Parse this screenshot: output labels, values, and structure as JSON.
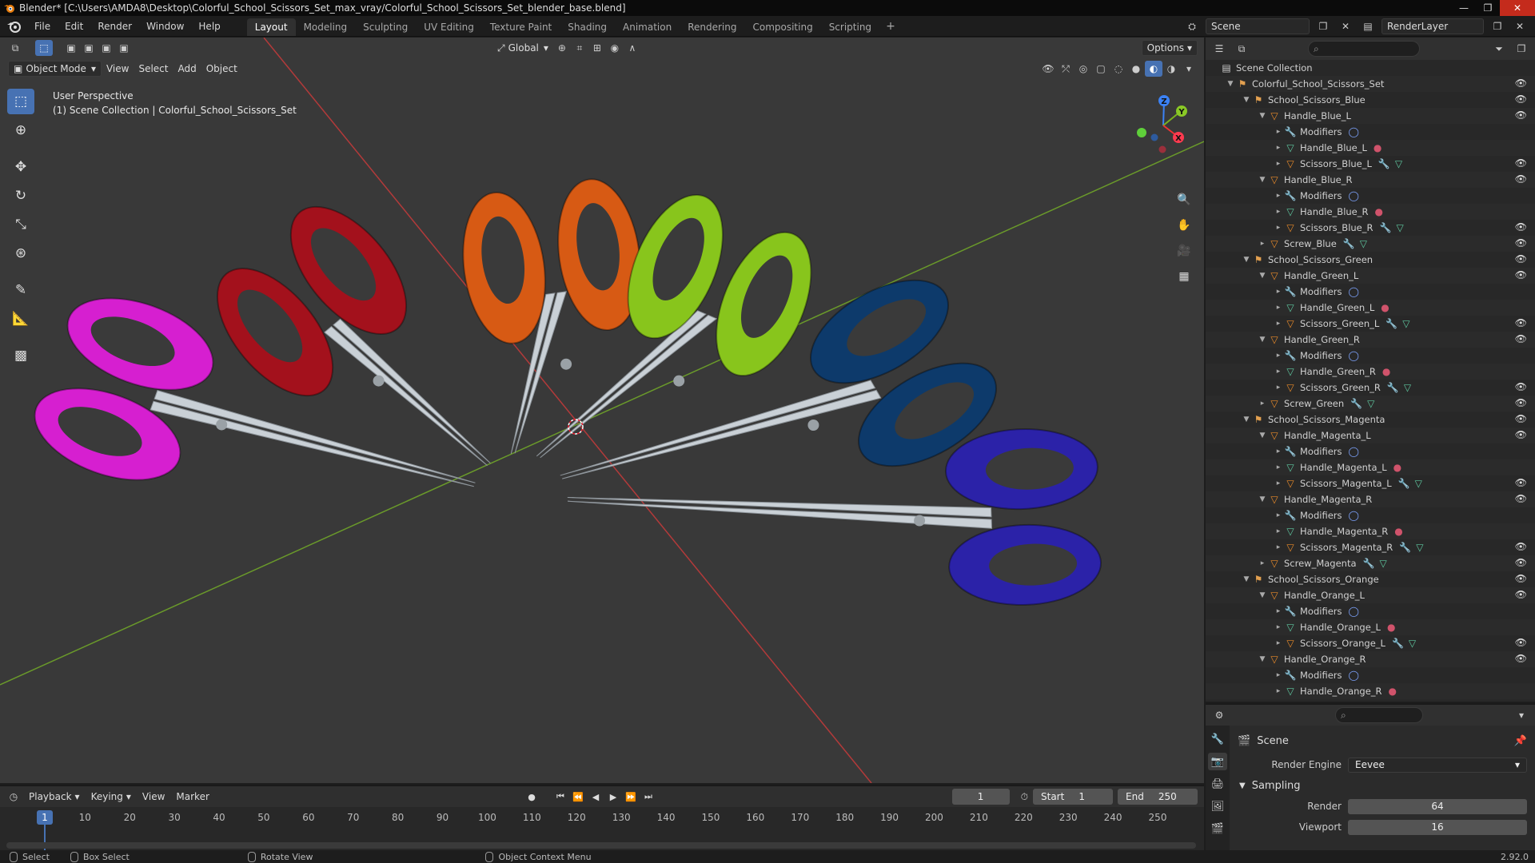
{
  "window": {
    "title": "Blender* [C:\\Users\\AMDA8\\Desktop\\Colorful_School_Scissors_Set_max_vray/Colorful_School_Scissors_Set_blender_base.blend]"
  },
  "menu": [
    "File",
    "Edit",
    "Render",
    "Window",
    "Help"
  ],
  "workspaces": [
    {
      "label": "Layout",
      "active": true
    },
    {
      "label": "Modeling"
    },
    {
      "label": "Sculpting"
    },
    {
      "label": "UV Editing"
    },
    {
      "label": "Texture Paint"
    },
    {
      "label": "Shading"
    },
    {
      "label": "Animation"
    },
    {
      "label": "Rendering"
    },
    {
      "label": "Compositing"
    },
    {
      "label": "Scripting"
    }
  ],
  "topright": {
    "scene": "Scene",
    "renderlayer": "RenderLayer"
  },
  "viewport": {
    "transform_orientation": "Global",
    "options_label": "Options",
    "mode": "Object Mode",
    "menus": [
      "View",
      "Select",
      "Add",
      "Object"
    ],
    "perspective_text": "User Perspective",
    "collection_text": "(1) Scene Collection | Colorful_School_Scissors_Set",
    "gizmo_axes": {
      "x": "X",
      "y": "Y",
      "z": "Z"
    },
    "colors": {
      "bg": "#393939",
      "grid_x": "#b33a3a",
      "grid_y": "#6a9a2a"
    },
    "scissors": [
      {
        "name": "magenta",
        "color": "#d61fd0"
      },
      {
        "name": "red",
        "color": "#a3111c"
      },
      {
        "name": "orange",
        "color": "#d75a14"
      },
      {
        "name": "green",
        "color": "#88c51c"
      },
      {
        "name": "blue",
        "color": "#0d3a6b"
      },
      {
        "name": "indigo",
        "color": "#2b22a8"
      }
    ]
  },
  "outliner": {
    "rows": [
      {
        "label": "Scene Collection",
        "icon": "scene-collection",
        "depth": 0,
        "arrow": "",
        "eye": false
      },
      {
        "label": "Colorful_School_Scissors_Set",
        "icon": "collection",
        "depth": 1,
        "arrow": "▼",
        "eye": true
      },
      {
        "label": "School_Scissors_Blue",
        "icon": "collection",
        "depth": 2,
        "arrow": "▼",
        "eye": true
      },
      {
        "label": "Handle_Blue_L",
        "icon": "object",
        "depth": 3,
        "arrow": "▼",
        "eye": true
      },
      {
        "label": "Modifiers",
        "icon": "modifier",
        "depth": 4,
        "arrow": "▸",
        "extra": [
          "circle"
        ],
        "eye": false
      },
      {
        "label": "Handle_Blue_L",
        "icon": "mesh",
        "depth": 4,
        "arrow": "▸",
        "extra": [
          "material"
        ],
        "eye": false
      },
      {
        "label": "Scissors_Blue_L",
        "icon": "object",
        "depth": 4,
        "arrow": "▸",
        "extra": [
          "wrench",
          "mesh"
        ],
        "eye": true
      },
      {
        "label": "Handle_Blue_R",
        "icon": "object",
        "depth": 3,
        "arrow": "▼",
        "eye": true
      },
      {
        "label": "Modifiers",
        "icon": "modifier",
        "depth": 4,
        "arrow": "▸",
        "extra": [
          "circle"
        ],
        "eye": false
      },
      {
        "label": "Handle_Blue_R",
        "icon": "mesh",
        "depth": 4,
        "arrow": "▸",
        "extra": [
          "material"
        ],
        "eye": false
      },
      {
        "label": "Scissors_Blue_R",
        "icon": "object",
        "depth": 4,
        "arrow": "▸",
        "extra": [
          "wrench",
          "mesh"
        ],
        "eye": true
      },
      {
        "label": "Screw_Blue",
        "icon": "object",
        "depth": 3,
        "arrow": "▸",
        "extra": [
          "wrench",
          "mesh"
        ],
        "eye": true
      },
      {
        "label": "School_Scissors_Green",
        "icon": "collection",
        "depth": 2,
        "arrow": "▼",
        "eye": true
      },
      {
        "label": "Handle_Green_L",
        "icon": "object",
        "depth": 3,
        "arrow": "▼",
        "eye": true
      },
      {
        "label": "Modifiers",
        "icon": "modifier",
        "depth": 4,
        "arrow": "▸",
        "extra": [
          "circle"
        ],
        "eye": false
      },
      {
        "label": "Handle_Green_L",
        "icon": "mesh",
        "depth": 4,
        "arrow": "▸",
        "extra": [
          "material"
        ],
        "eye": false
      },
      {
        "label": "Scissors_Green_L",
        "icon": "object",
        "depth": 4,
        "arrow": "▸",
        "extra": [
          "wrench",
          "mesh"
        ],
        "eye": true
      },
      {
        "label": "Handle_Green_R",
        "icon": "object",
        "depth": 3,
        "arrow": "▼",
        "eye": true
      },
      {
        "label": "Modifiers",
        "icon": "modifier",
        "depth": 4,
        "arrow": "▸",
        "extra": [
          "circle"
        ],
        "eye": false
      },
      {
        "label": "Handle_Green_R",
        "icon": "mesh",
        "depth": 4,
        "arrow": "▸",
        "extra": [
          "material"
        ],
        "eye": false
      },
      {
        "label": "Scissors_Green_R",
        "icon": "object",
        "depth": 4,
        "arrow": "▸",
        "extra": [
          "wrench",
          "mesh"
        ],
        "eye": true
      },
      {
        "label": "Screw_Green",
        "icon": "object",
        "depth": 3,
        "arrow": "▸",
        "extra": [
          "wrench",
          "mesh"
        ],
        "eye": true
      },
      {
        "label": "School_Scissors_Magenta",
        "icon": "collection",
        "depth": 2,
        "arrow": "▼",
        "eye": true
      },
      {
        "label": "Handle_Magenta_L",
        "icon": "object",
        "depth": 3,
        "arrow": "▼",
        "eye": true
      },
      {
        "label": "Modifiers",
        "icon": "modifier",
        "depth": 4,
        "arrow": "▸",
        "extra": [
          "circle"
        ],
        "eye": false
      },
      {
        "label": "Handle_Magenta_L",
        "icon": "mesh",
        "depth": 4,
        "arrow": "▸",
        "extra": [
          "material"
        ],
        "eye": false
      },
      {
        "label": "Scissors_Magenta_L",
        "icon": "object",
        "depth": 4,
        "arrow": "▸",
        "extra": [
          "wrench",
          "mesh"
        ],
        "eye": true
      },
      {
        "label": "Handle_Magenta_R",
        "icon": "object",
        "depth": 3,
        "arrow": "▼",
        "eye": true
      },
      {
        "label": "Modifiers",
        "icon": "modifier",
        "depth": 4,
        "arrow": "▸",
        "extra": [
          "circle"
        ],
        "eye": false
      },
      {
        "label": "Handle_Magenta_R",
        "icon": "mesh",
        "depth": 4,
        "arrow": "▸",
        "extra": [
          "material"
        ],
        "eye": false
      },
      {
        "label": "Scissors_Magenta_R",
        "icon": "object",
        "depth": 4,
        "arrow": "▸",
        "extra": [
          "wrench",
          "mesh"
        ],
        "eye": true
      },
      {
        "label": "Screw_Magenta",
        "icon": "object",
        "depth": 3,
        "arrow": "▸",
        "extra": [
          "wrench",
          "mesh"
        ],
        "eye": true
      },
      {
        "label": "School_Scissors_Orange",
        "icon": "collection",
        "depth": 2,
        "arrow": "▼",
        "eye": true
      },
      {
        "label": "Handle_Orange_L",
        "icon": "object",
        "depth": 3,
        "arrow": "▼",
        "eye": true
      },
      {
        "label": "Modifiers",
        "icon": "modifier",
        "depth": 4,
        "arrow": "▸",
        "extra": [
          "circle"
        ],
        "eye": false
      },
      {
        "label": "Handle_Orange_L",
        "icon": "mesh",
        "depth": 4,
        "arrow": "▸",
        "extra": [
          "material"
        ],
        "eye": false
      },
      {
        "label": "Scissors_Orange_L",
        "icon": "object",
        "depth": 4,
        "arrow": "▸",
        "extra": [
          "wrench",
          "mesh"
        ],
        "eye": true
      },
      {
        "label": "Handle_Orange_R",
        "icon": "object",
        "depth": 3,
        "arrow": "▼",
        "eye": true
      },
      {
        "label": "Modifiers",
        "icon": "modifier",
        "depth": 4,
        "arrow": "▸",
        "extra": [
          "circle"
        ],
        "eye": false
      },
      {
        "label": "Handle_Orange_R",
        "icon": "mesh",
        "depth": 4,
        "arrow": "▸",
        "extra": [
          "material"
        ],
        "eye": false
      }
    ]
  },
  "properties": {
    "context": "Scene",
    "render_engine_label": "Render Engine",
    "render_engine": "Eevee",
    "section": "Sampling",
    "render_label": "Render",
    "render_value": "64",
    "viewport_label": "Viewport",
    "viewport_value": "16"
  },
  "timeline": {
    "menus": [
      "Playback",
      "Keying",
      "View",
      "Marker"
    ],
    "current_frame": "1",
    "start_label": "Start",
    "start": "1",
    "end_label": "End",
    "end": "250",
    "ticks": [
      "10",
      "20",
      "30",
      "40",
      "50",
      "60",
      "70",
      "80",
      "90",
      "100",
      "110",
      "120",
      "130",
      "140",
      "150",
      "160",
      "170",
      "180",
      "190",
      "200",
      "210",
      "220",
      "230",
      "240",
      "250"
    ],
    "cursor_label": "1"
  },
  "status": {
    "select": "Select",
    "box_select": "Box Select",
    "rotate_view": "Rotate View",
    "context_menu": "Object Context Menu",
    "version": "2.92.0"
  }
}
